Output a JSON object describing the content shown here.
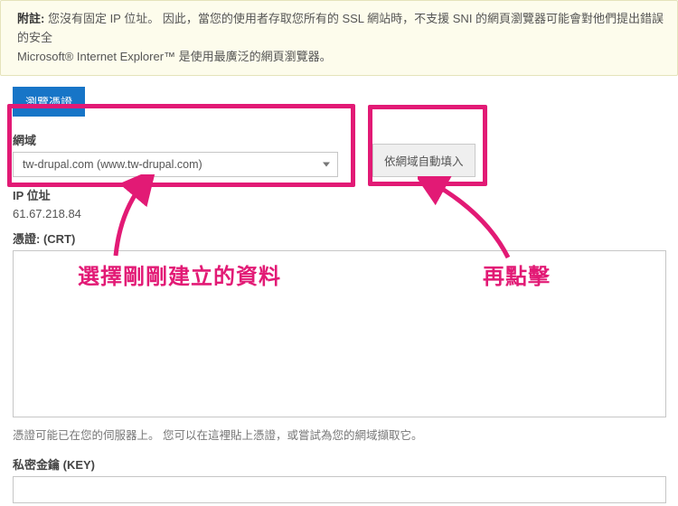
{
  "notice": {
    "prefix_bold": "附註:",
    "line1_after": " 您沒有固定 IP 位址。 因此，當您的使用者存取您所有的 SSL 網站時，不支援 SNI 的網頁瀏覽器可能會對他們提出錯誤的安全",
    "line2": "Microsoft® Internet Explorer™ 是使用最廣泛的網頁瀏覽器。"
  },
  "buttons": {
    "browse_cert": "瀏覽憑證",
    "autofill_by_domain": "依網域自動填入"
  },
  "domain": {
    "label": "網域",
    "selected": "tw-drupal.com   (www.tw-drupal.com)"
  },
  "ip": {
    "label": "IP 位址",
    "value": "61.67.218.84"
  },
  "cert": {
    "label": "憑證: (CRT)",
    "help": "憑證可能已在您的伺服器上。 您可以在這裡貼上憑證，或嘗試為您的網域擷取它。"
  },
  "key": {
    "label": "私密金鑰 (KEY)"
  },
  "annotations": {
    "left": "選擇剛剛建立的資料",
    "right": "再點擊"
  }
}
